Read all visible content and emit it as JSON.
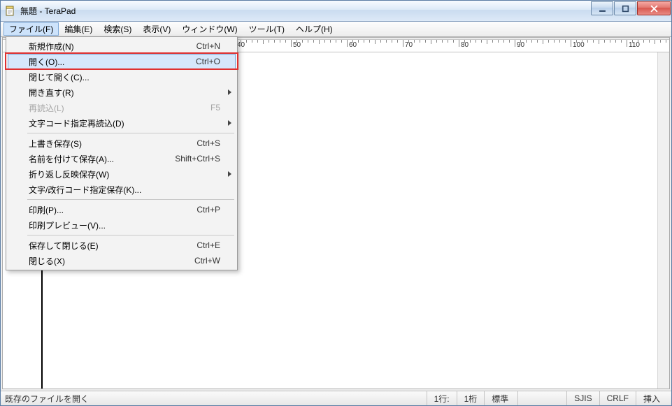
{
  "title": "無題 - TeraPad",
  "menubar": [
    "ファイル(F)",
    "編集(E)",
    "検索(S)",
    "表示(V)",
    "ウィンドウ(W)",
    "ツール(T)",
    "ヘルプ(H)"
  ],
  "dropdown": {
    "groups": [
      [
        {
          "label": "新規作成(N)",
          "accel": "Ctrl+N"
        },
        {
          "label": "開く(O)...",
          "accel": "Ctrl+O",
          "highlight": true
        },
        {
          "label": "閉じて開く(C)...",
          "accel": ""
        },
        {
          "label": "開き直す(R)",
          "accel": "",
          "submenu": true
        },
        {
          "label": "再読込(L)",
          "accel": "F5",
          "disabled": true
        },
        {
          "label": "文字コード指定再読込(D)",
          "accel": "",
          "submenu": true
        }
      ],
      [
        {
          "label": "上書き保存(S)",
          "accel": "Ctrl+S"
        },
        {
          "label": "名前を付けて保存(A)...",
          "accel": "Shift+Ctrl+S"
        },
        {
          "label": "折り返し反映保存(W)",
          "accel": "",
          "submenu": true
        },
        {
          "label": "文字/改行コード指定保存(K)...",
          "accel": ""
        }
      ],
      [
        {
          "label": "印刷(P)...",
          "accel": "Ctrl+P"
        },
        {
          "label": "印刷プレビュー(V)...",
          "accel": ""
        }
      ],
      [
        {
          "label": "保存して閉じる(E)",
          "accel": "Ctrl+E"
        },
        {
          "label": "閉じる(X)",
          "accel": "Ctrl+W"
        }
      ]
    ]
  },
  "status": {
    "help": "既存のファイルを開く",
    "line": "1行:",
    "col": "1桁",
    "mode": "標準",
    "enc": "SJIS",
    "eol": "CRLF",
    "ins": "挿入"
  }
}
